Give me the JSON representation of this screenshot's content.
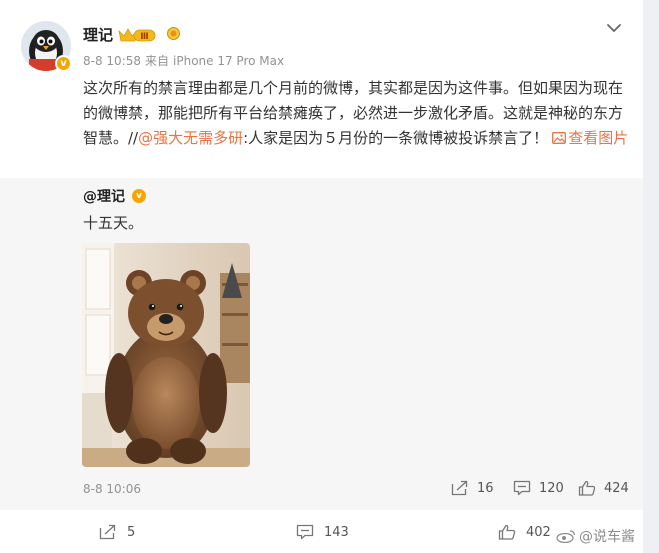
{
  "post": {
    "username": "理记",
    "level_badge": "Ⅲ",
    "verified_mark": "v",
    "timestamp": "8-8 10:58",
    "source_prefix": "来自",
    "device": "iPhone 17 Pro Max",
    "text_main": "这次所有的禁言理由都是几个月前的微博，其实都是因为这件事。但如果因为现在的微博禁，那能把所有平台给禁瘫痪了，必然进一步激化矛盾。这就是神秘的东方智慧。//",
    "mention": "@强大无需多研",
    "text_quote": ":人家是因为５月份的一条微博被投诉禁言了！",
    "view_image_label": "查看图片"
  },
  "retweet": {
    "author": "@理记",
    "verified_mark": "v",
    "text": "十五天。",
    "timestamp": "8-8 10:06",
    "reposts": "16",
    "comments": "120",
    "likes": "424"
  },
  "footer": {
    "reposts": "5",
    "comments": "143",
    "likes": "402"
  },
  "watermark": "@说车酱",
  "icons": {
    "chevron": "chevron-down-icon",
    "repost": "repost-icon",
    "comment": "comment-icon",
    "like": "thumbs-up-icon",
    "image": "image-icon"
  },
  "colors": {
    "link": "#eb7340",
    "meta": "#939393",
    "retweet_bg": "#f6f6f6",
    "verified": "#f7a600"
  }
}
